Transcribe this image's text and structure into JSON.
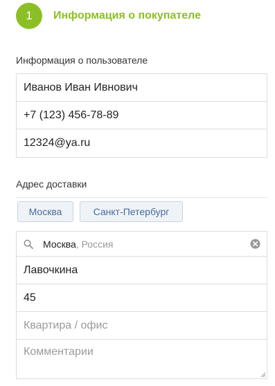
{
  "step": {
    "number": "1",
    "title": "Информация о покупателе"
  },
  "user_section": {
    "label": "Информация о пользователе",
    "fields": {
      "name": "Иванов Иван Ивнович",
      "phone": "+7 (123) 456-78-89",
      "email": "12324@ya.ru"
    }
  },
  "address_section": {
    "label": "Адрес доставки",
    "city_buttons": [
      "Москва",
      "Санкт-Петербург"
    ],
    "search": {
      "value": "Москва",
      "suffix": ", Россия"
    },
    "street": "Лавочкина",
    "house": "45",
    "apartment_placeholder": "Квартира / офис",
    "comment_placeholder": "Комментарии"
  },
  "colors": {
    "accent": "#8cbf26",
    "city_button_text": "#4a6a9a",
    "border": "#dcdcdc"
  }
}
